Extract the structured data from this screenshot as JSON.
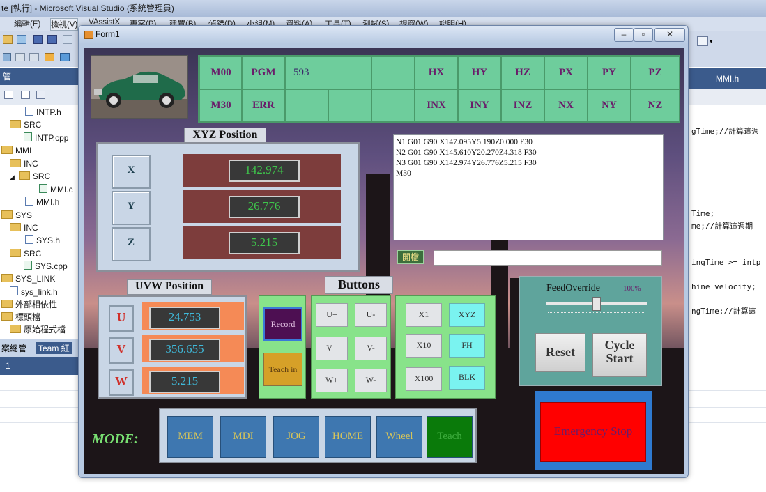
{
  "vs": {
    "title": "te [執行] - Microsoft Visual Studio (系統管理員)",
    "menu": [
      "編輯(E)",
      "檢視(V)",
      "VAssistX",
      "專案(P)",
      "建置(B)",
      "偵錯(D)",
      "小組(M)",
      "資料(A)",
      "工具(T)",
      "測試(S)",
      "視窗(W)",
      "說明(H)"
    ],
    "panel_header": "管",
    "tree": [
      {
        "label": "INTP.h",
        "kind": "h"
      },
      {
        "label": "SRC",
        "kind": "folder"
      },
      {
        "label": "INTP.cpp",
        "kind": "c"
      },
      {
        "label": "MMI",
        "kind": "folder"
      },
      {
        "label": "INC",
        "kind": "folder"
      },
      {
        "label": "SRC",
        "kind": "folder"
      },
      {
        "label": "MMI.c",
        "kind": "c"
      },
      {
        "label": "MMI.h",
        "kind": "h"
      },
      {
        "label": "SYS",
        "kind": "folder"
      },
      {
        "label": "INC",
        "kind": "folder"
      },
      {
        "label": "SYS.h",
        "kind": "h"
      },
      {
        "label": "SRC",
        "kind": "folder"
      },
      {
        "label": "SYS.cpp",
        "kind": "c"
      },
      {
        "label": "SYS_LINK",
        "kind": "folder"
      },
      {
        "label": "sys_link.h",
        "kind": "h"
      },
      {
        "label": "外部相依性",
        "kind": "folder"
      },
      {
        "label": "標頭檔",
        "kind": "folder"
      },
      {
        "label": "原始程式檔",
        "kind": "folder"
      }
    ],
    "bottom_tabs": [
      "案總管",
      "Team 紅"
    ],
    "bottom_bar": "1",
    "code_tab": "MMI.h",
    "code_lines": [
      "gTime;//計算這週",
      "Time;",
      "me;//計算這週期",
      "ingTime >= intp",
      "hine_velocity;",
      "ngTime;//計算這"
    ]
  },
  "form": {
    "title": "Form1",
    "status": {
      "row1": [
        "M00",
        "PGM",
        "593",
        "",
        "",
        "HX",
        "HY",
        "HZ",
        "PX",
        "PY",
        "PZ"
      ],
      "row2": [
        "M30",
        "ERR",
        "",
        "",
        "",
        "INX",
        "INY",
        "INZ",
        "NX",
        "NY",
        "NZ"
      ]
    },
    "xyz": {
      "title": "XYZ Position",
      "axes": [
        {
          "label": "X",
          "value": "142.974"
        },
        {
          "label": "Y",
          "value": "26.776"
        },
        {
          "label": "Z",
          "value": "5.215"
        }
      ]
    },
    "uvw": {
      "title": "UVW Position",
      "axes": [
        {
          "label": "U",
          "value": "24.753"
        },
        {
          "label": "V",
          "value": "356.655"
        },
        {
          "label": "W",
          "value": "5.215"
        }
      ]
    },
    "program": {
      "lines": [
        "N1 G01 G90 X147.095Y5.190Z0.000 F30",
        "N2 G01 G90 X145.610Y20.270Z4.318 F30",
        "N3 G01 G90 X142.974Y26.776Z5.215 F30",
        "M30"
      ],
      "open_button": "開檔",
      "path_value": ""
    },
    "buttons": {
      "title": "Buttons",
      "record": "Record",
      "teach_in": "Teach in",
      "jog": [
        "U+",
        "U-",
        "V+",
        "V-",
        "W+",
        "W-"
      ],
      "steps": [
        "X1",
        "X10",
        "X100"
      ],
      "modes2": [
        "XYZ",
        "FH",
        "BLK"
      ]
    },
    "feed": {
      "label": "FeedOverride",
      "value": "100%",
      "reset": "Reset",
      "cycle_start_1": "Cycle",
      "cycle_start_2": "Start"
    },
    "emergency": "Emergency Stop",
    "mode": {
      "label": "MODE:",
      "buttons": [
        "MEM",
        "MDI",
        "JOG",
        "HOME",
        "Wheel",
        "Teach"
      ]
    }
  },
  "colors": {
    "status_bg": "#6ecd9c",
    "axis_bar": "#7d3d3c",
    "uvw_bar": "#f58a56",
    "value_green": "#3ec54b",
    "value_cyan": "#3fb9d9",
    "emergency": "#ff0000"
  }
}
